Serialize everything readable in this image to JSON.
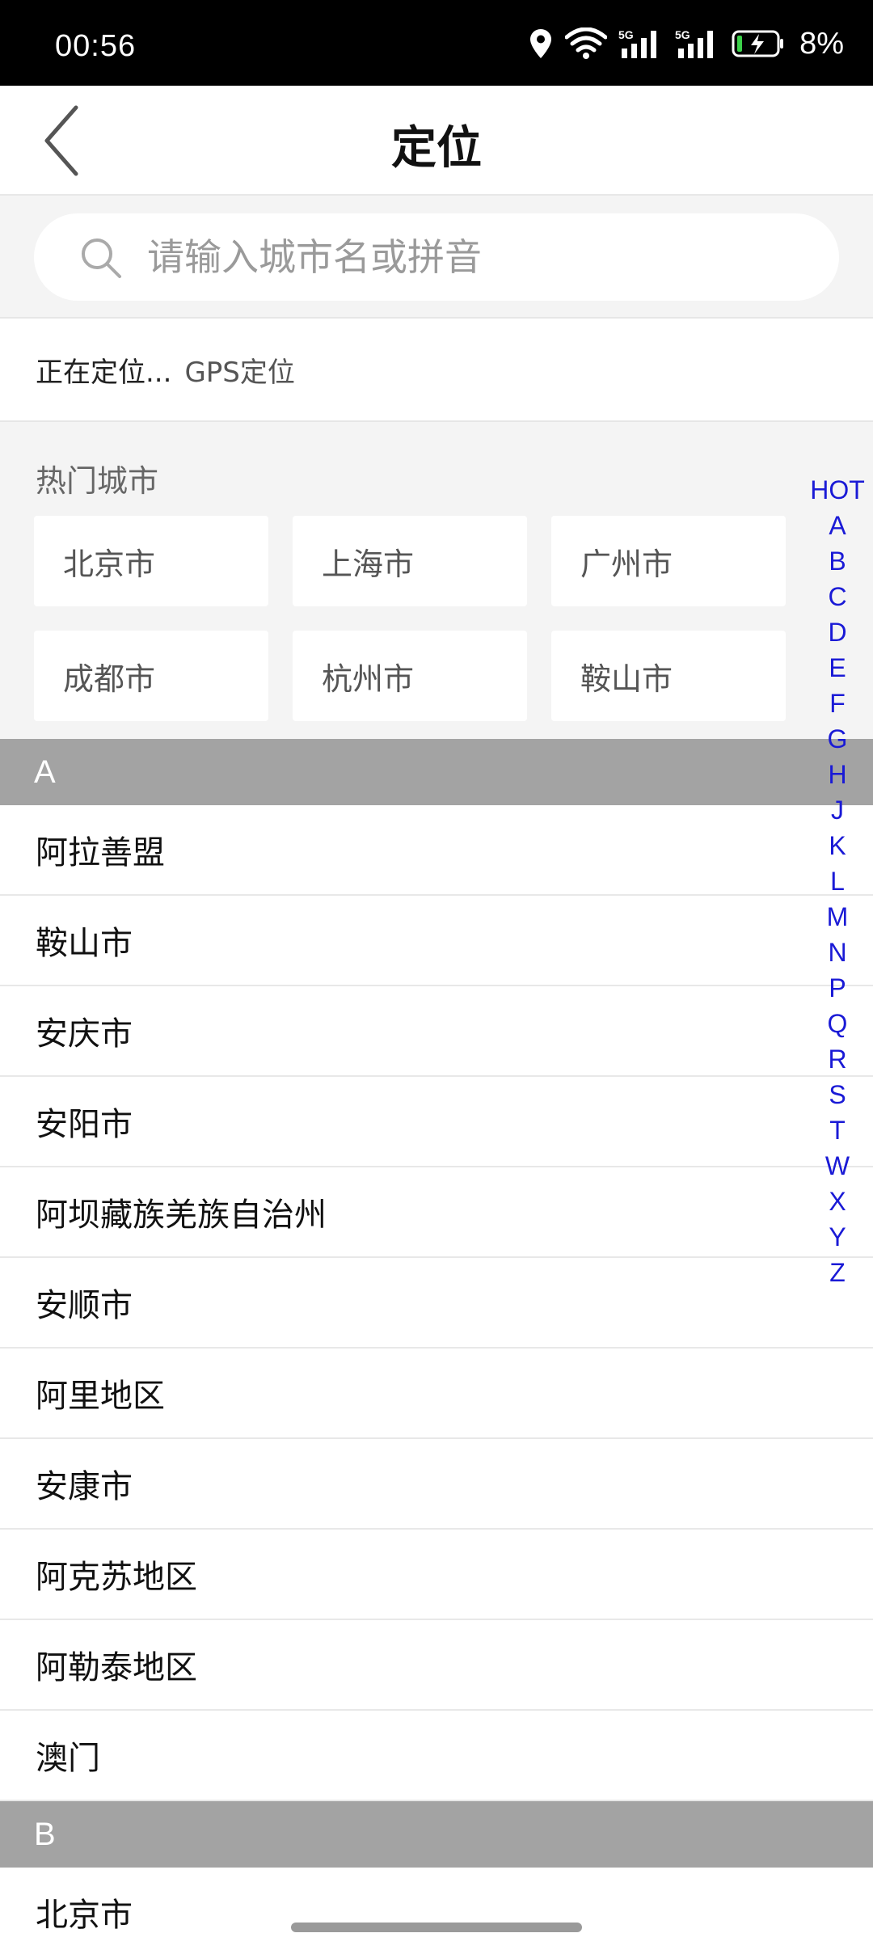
{
  "status_bar": {
    "time": "00:56",
    "battery": "8%",
    "icons": [
      "location-pin-icon",
      "wifi-icon",
      "signal-5g-icon",
      "signal-5g-icon",
      "battery-charging-icon"
    ],
    "net1": "5G",
    "net2": "5G"
  },
  "header": {
    "title": "定位",
    "back_icon": "chevron-left-icon"
  },
  "search": {
    "placeholder": "请输入城市名或拼音",
    "icon": "search-icon"
  },
  "location": {
    "status": "正在定位...",
    "gps": "GPS定位"
  },
  "hot_cities": {
    "title": "热门城市",
    "items": [
      "北京市",
      "上海市",
      "广州市",
      "成都市",
      "杭州市",
      "鞍山市"
    ]
  },
  "index_letters": [
    "HOT",
    "A",
    "B",
    "C",
    "D",
    "E",
    "F",
    "G",
    "H",
    "J",
    "K",
    "L",
    "M",
    "N",
    "P",
    "Q",
    "R",
    "S",
    "T",
    "W",
    "X",
    "Y",
    "Z"
  ],
  "groups": [
    {
      "letter": "A",
      "cities": [
        "阿拉善盟",
        "鞍山市",
        "安庆市",
        "安阳市",
        "阿坝藏族羌族自治州",
        "安顺市",
        "阿里地区",
        "安康市",
        "阿克苏地区",
        "阿勒泰地区",
        "澳门"
      ]
    },
    {
      "letter": "B",
      "cities": [
        "北京市"
      ]
    }
  ],
  "colors": {
    "index_blue": "#1a1ad6",
    "group_header_bg": "#a3a3a3",
    "section_bg": "#f4f4f4"
  }
}
